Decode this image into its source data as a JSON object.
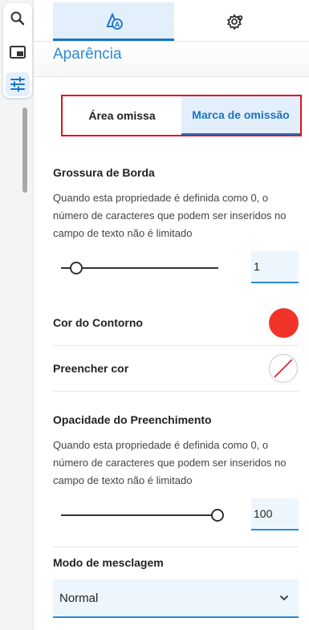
{
  "rail": {
    "buttons": [
      {
        "name": "search-icon",
        "active": false
      },
      {
        "name": "panel-icon",
        "active": false
      },
      {
        "name": "sliders-icon",
        "active": true
      }
    ]
  },
  "header": {
    "tabs": [
      {
        "name": "appearance-tab-icon",
        "active": true
      },
      {
        "name": "gear-icon",
        "active": false
      }
    ]
  },
  "section_title": "Aparência",
  "subtabs": [
    {
      "label": "Área omissa",
      "active": false
    },
    {
      "label": "Marca de omissão",
      "active": true
    }
  ],
  "border_thickness": {
    "label": "Grossura de Borda",
    "description": "Quando esta propriedade é definida como 0, o número de caracteres que podem ser inseridos no campo de texto não é limitado",
    "value": "1",
    "slider_fraction": 0.1
  },
  "outline_color": {
    "label": "Cor do Contorno",
    "color": "#f1342a"
  },
  "fill_color": {
    "label": "Preencher cor",
    "color": "none"
  },
  "fill_opacity": {
    "label": "Opacidade do Preenchimento",
    "description": "Quando esta propriedade é definida como 0, o número de caracteres que podem ser inseridos no campo de texto não é limitado",
    "value": "100",
    "slider_fraction": 1.0
  },
  "blend_mode": {
    "label": "Modo de mesclagem",
    "value": "Normal"
  },
  "colors": {
    "accent": "#2a8ad8",
    "highlight_border": "#e0131f",
    "active_bg": "#e3f0fb"
  }
}
